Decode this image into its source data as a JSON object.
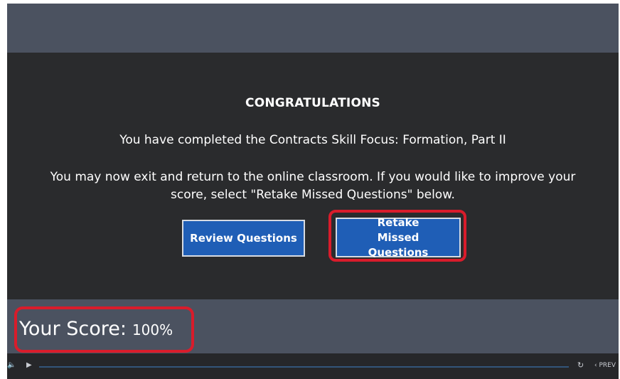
{
  "main": {
    "heading": "CONGRATULATIONS",
    "completed_text": "You have completed the Contracts Skill Focus: Formation, Part II",
    "instructions_text": "You may now exit and return to the online classroom. If you would like to improve your score, select \"Retake Missed Questions\" below.",
    "review_button_label": "Review Questions",
    "retake_button_label": "Retake Missed Questions"
  },
  "score": {
    "label": "Your Score:",
    "value": "100%"
  },
  "player": {
    "volume_icon": "🔈",
    "play_icon": "▶",
    "reload_icon": "↻",
    "prev_label": "‹ PREV",
    "progress": 0
  },
  "colors": {
    "button_blue": "#1f5eb6",
    "highlight_red": "#d91c2b",
    "panel_slate": "#4b5260",
    "content_dark": "#2a2b2d"
  }
}
